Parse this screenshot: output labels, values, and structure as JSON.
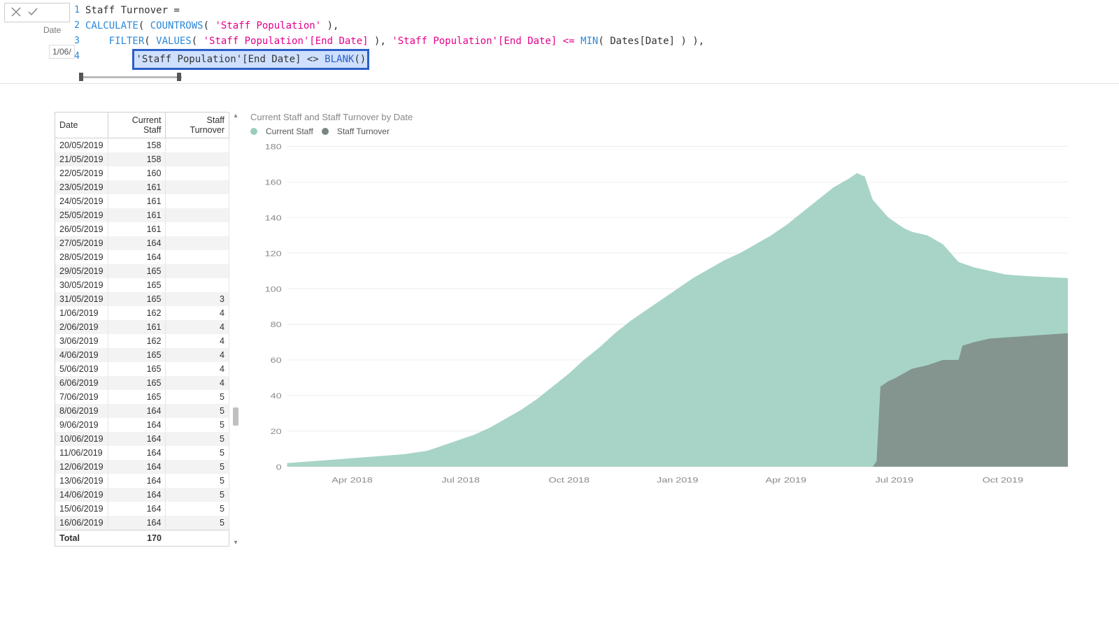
{
  "formula": {
    "measure_name": "Staff Turnover",
    "line2_a": "CALCULATE",
    "line2_b": "COUNTROWS",
    "line2_c": "'Staff Population'",
    "line3_a": "FILTER",
    "line3_b": "VALUES",
    "line3_c": "'Staff Population'[End Date]",
    "line3_d": "'Staff Population'[End Date] <=",
    "line3_e": "MIN",
    "line3_f": "Dates[Date]",
    "line4_hl_a": "'Staff Population'[End Date] <>",
    "line4_hl_b": "BLANK",
    "peek_label": "Date",
    "peek_value": "1/06/"
  },
  "table": {
    "headers": [
      "Date",
      "Current Staff",
      "Staff Turnover"
    ],
    "rows": [
      [
        "20/05/2019",
        158,
        ""
      ],
      [
        "21/05/2019",
        158,
        ""
      ],
      [
        "22/05/2019",
        160,
        ""
      ],
      [
        "23/05/2019",
        161,
        ""
      ],
      [
        "24/05/2019",
        161,
        ""
      ],
      [
        "25/05/2019",
        161,
        ""
      ],
      [
        "26/05/2019",
        161,
        ""
      ],
      [
        "27/05/2019",
        164,
        ""
      ],
      [
        "28/05/2019",
        164,
        ""
      ],
      [
        "29/05/2019",
        165,
        ""
      ],
      [
        "30/05/2019",
        165,
        ""
      ],
      [
        "31/05/2019",
        165,
        3
      ],
      [
        "1/06/2019",
        162,
        4
      ],
      [
        "2/06/2019",
        161,
        4
      ],
      [
        "3/06/2019",
        162,
        4
      ],
      [
        "4/06/2019",
        165,
        4
      ],
      [
        "5/06/2019",
        165,
        4
      ],
      [
        "6/06/2019",
        165,
        4
      ],
      [
        "7/06/2019",
        165,
        5
      ],
      [
        "8/06/2019",
        164,
        5
      ],
      [
        "9/06/2019",
        164,
        5
      ],
      [
        "10/06/2019",
        164,
        5
      ],
      [
        "11/06/2019",
        164,
        5
      ],
      [
        "12/06/2019",
        164,
        5
      ],
      [
        "13/06/2019",
        164,
        5
      ],
      [
        "14/06/2019",
        164,
        5
      ],
      [
        "15/06/2019",
        164,
        5
      ],
      [
        "16/06/2019",
        164,
        5
      ]
    ],
    "total_label": "Total",
    "total_value": 170
  },
  "chart_data": {
    "type": "area",
    "title": "Current Staff and Staff Turnover by Date",
    "xlabel": "",
    "ylabel": "",
    "ylim": [
      0,
      180
    ],
    "y_ticks": [
      0,
      20,
      40,
      60,
      80,
      100,
      120,
      140,
      160,
      180
    ],
    "x_ticks": [
      "Apr 2018",
      "Jul 2018",
      "Oct 2018",
      "Jan 2019",
      "Apr 2019",
      "Jul 2019",
      "Oct 2019"
    ],
    "legend": [
      "Current Staff",
      "Staff Turnover"
    ],
    "colors": {
      "current": "#98cdbd",
      "turnover": "#7a8580"
    },
    "series": [
      {
        "name": "Current Staff",
        "points": [
          [
            0.0,
            2
          ],
          [
            0.03,
            3
          ],
          [
            0.06,
            4
          ],
          [
            0.09,
            5
          ],
          [
            0.12,
            6
          ],
          [
            0.15,
            7
          ],
          [
            0.18,
            9
          ],
          [
            0.2,
            12
          ],
          [
            0.22,
            15
          ],
          [
            0.24,
            18
          ],
          [
            0.26,
            22
          ],
          [
            0.28,
            27
          ],
          [
            0.3,
            32
          ],
          [
            0.32,
            38
          ],
          [
            0.34,
            45
          ],
          [
            0.36,
            52
          ],
          [
            0.38,
            60
          ],
          [
            0.4,
            67
          ],
          [
            0.42,
            75
          ],
          [
            0.44,
            82
          ],
          [
            0.46,
            88
          ],
          [
            0.48,
            94
          ],
          [
            0.5,
            100
          ],
          [
            0.52,
            106
          ],
          [
            0.54,
            111
          ],
          [
            0.56,
            116
          ],
          [
            0.58,
            120
          ],
          [
            0.6,
            125
          ],
          [
            0.62,
            130
          ],
          [
            0.64,
            136
          ],
          [
            0.66,
            143
          ],
          [
            0.68,
            150
          ],
          [
            0.7,
            157
          ],
          [
            0.72,
            162
          ],
          [
            0.73,
            165
          ],
          [
            0.74,
            163
          ],
          [
            0.75,
            150
          ],
          [
            0.77,
            140
          ],
          [
            0.79,
            134
          ],
          [
            0.8,
            132
          ],
          [
            0.82,
            130
          ],
          [
            0.84,
            125
          ],
          [
            0.86,
            115
          ],
          [
            0.88,
            112
          ],
          [
            0.9,
            110
          ],
          [
            0.92,
            108
          ],
          [
            0.95,
            107
          ],
          [
            1.0,
            106
          ]
        ]
      },
      {
        "name": "Staff Turnover",
        "points": [
          [
            0.75,
            0
          ],
          [
            0.755,
            3
          ],
          [
            0.76,
            45
          ],
          [
            0.77,
            48
          ],
          [
            0.78,
            50
          ],
          [
            0.8,
            55
          ],
          [
            0.82,
            57
          ],
          [
            0.84,
            60
          ],
          [
            0.86,
            60
          ],
          [
            0.865,
            68
          ],
          [
            0.88,
            70
          ],
          [
            0.9,
            72
          ],
          [
            1.0,
            75
          ]
        ]
      }
    ]
  }
}
